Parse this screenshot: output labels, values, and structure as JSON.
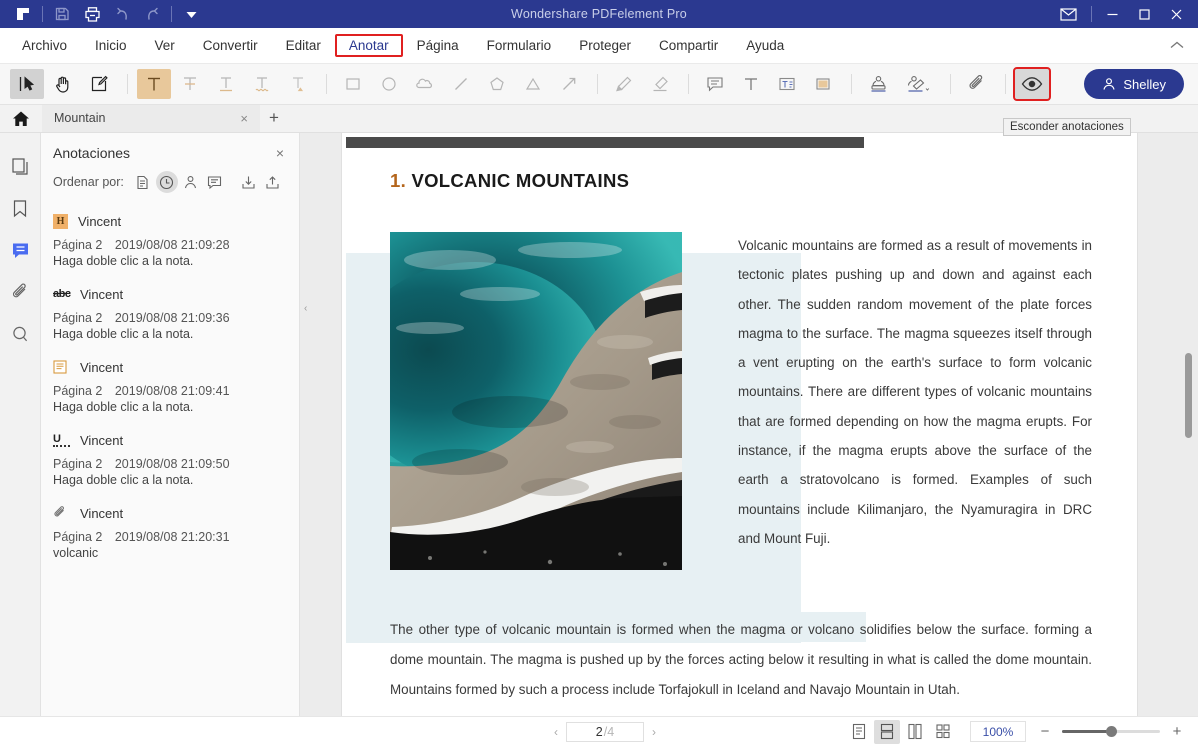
{
  "titlebar": {
    "app_title": "Wondershare PDFelement Pro",
    "background": "#2b3990",
    "left_tools": [
      {
        "name": "logo-icon",
        "label": "PDFelement"
      },
      {
        "name": "save-icon",
        "label": "Guardar"
      },
      {
        "name": "print-icon",
        "label": "Imprimir"
      },
      {
        "name": "undo-icon",
        "label": "Deshacer"
      },
      {
        "name": "redo-icon",
        "label": "Rehacer"
      },
      {
        "name": "customize-dropdown-icon",
        "label": "Personalizar"
      }
    ],
    "right_tools": [
      {
        "name": "mail-icon",
        "label": "Correo"
      },
      {
        "name": "minimize-button",
        "label": "Minimizar"
      },
      {
        "name": "maximize-button",
        "label": "Maximizar"
      },
      {
        "name": "close-button",
        "label": "Cerrar"
      }
    ]
  },
  "menubar": {
    "items": [
      {
        "label": "Archivo",
        "active": false
      },
      {
        "label": "Inicio",
        "active": false
      },
      {
        "label": "Ver",
        "active": false
      },
      {
        "label": "Convertir",
        "active": false
      },
      {
        "label": "Editar",
        "active": false
      },
      {
        "label": "Anotar",
        "active": true
      },
      {
        "label": "Página",
        "active": false
      },
      {
        "label": "Formulario",
        "active": false
      },
      {
        "label": "Proteger",
        "active": false
      },
      {
        "label": "Compartir",
        "active": false
      },
      {
        "label": "Ayuda",
        "active": false
      }
    ],
    "active_tab": "Anotar",
    "active_highlight_color": "#e02020"
  },
  "toolbar": {
    "tools": [
      {
        "name": "select-tool",
        "label": "Seleccionar",
        "selected": true
      },
      {
        "name": "hand-tool",
        "label": "Mano",
        "selected": false
      },
      {
        "name": "edit-note-tool",
        "label": "Editar nota",
        "selected": false
      },
      {
        "name": "highlight-tool",
        "label": "Resaltar",
        "selected": true
      },
      {
        "name": "strikethrough-tool",
        "label": "Tachado",
        "selected": false
      },
      {
        "name": "underline-tool",
        "label": "Subrayar",
        "selected": false
      },
      {
        "name": "squiggly-underline-tool",
        "label": "Subrayado ondulado",
        "selected": false
      },
      {
        "name": "caret-tool",
        "label": "Insertar texto",
        "selected": false
      },
      {
        "name": "rectangle-tool",
        "label": "Rectángulo",
        "selected": false
      },
      {
        "name": "ellipse-tool",
        "label": "Elipse",
        "selected": false
      },
      {
        "name": "cloud-tool",
        "label": "Nube",
        "selected": false
      },
      {
        "name": "line-tool",
        "label": "Línea",
        "selected": false
      },
      {
        "name": "polygon-tool",
        "label": "Polígono",
        "selected": false
      },
      {
        "name": "polyline-tool",
        "label": "Polilínea",
        "selected": false
      },
      {
        "name": "arrow-tool",
        "label": "Flecha",
        "selected": false
      },
      {
        "name": "pencil-tool",
        "label": "Lápiz",
        "selected": false
      },
      {
        "name": "eraser-tool",
        "label": "Borrador",
        "selected": false
      },
      {
        "name": "sticky-note-tool",
        "label": "Nota",
        "selected": false
      },
      {
        "name": "text-box-tool",
        "label": "Cuadro de texto",
        "selected": false
      },
      {
        "name": "typewriter-tool",
        "label": "Máquina de escribir",
        "selected": false
      },
      {
        "name": "text-area-tool",
        "label": "Área de texto",
        "selected": false
      },
      {
        "name": "stamp-tool",
        "label": "Sello",
        "selected": false
      },
      {
        "name": "signature-tool",
        "label": "Firma",
        "selected": false
      },
      {
        "name": "attachment-tool",
        "label": "Adjunto",
        "selected": false
      },
      {
        "name": "hide-annotations-tool",
        "label": "Esconder anotaciones",
        "selected": false,
        "outlined": true
      }
    ],
    "tooltip": "Esconder anotaciones",
    "user_name": "Shelley"
  },
  "tabstrip": {
    "home_label": "Inicio",
    "document_tab": "Mountain",
    "new_tab_label": "+"
  },
  "rail": {
    "items": [
      {
        "name": "sidebar-item-thumbnails",
        "label": "Miniaturas",
        "active": false
      },
      {
        "name": "sidebar-item-bookmarks",
        "label": "Marcadores",
        "active": false
      },
      {
        "name": "sidebar-item-comments",
        "label": "Comentarios",
        "active": true
      },
      {
        "name": "sidebar-item-attachments",
        "label": "Adjuntos",
        "active": false
      },
      {
        "name": "sidebar-item-search",
        "label": "Buscar",
        "active": false
      }
    ],
    "active_color": "#4a6cf0"
  },
  "annotations_panel": {
    "title": "Anotaciones",
    "close_label": "×",
    "sort_label": "Ordenar por:",
    "sort_options": [
      {
        "name": "sort-by-page-icon",
        "label": "Página",
        "active": false
      },
      {
        "name": "sort-by-time-icon",
        "label": "Hora",
        "active": true
      },
      {
        "name": "sort-by-author-icon",
        "label": "Autor",
        "active": false
      },
      {
        "name": "sort-by-type-icon",
        "label": "Tipo",
        "active": false
      }
    ],
    "actions": [
      {
        "name": "import-annotations-icon",
        "label": "Importar"
      },
      {
        "name": "export-annotations-icon",
        "label": "Exportar"
      }
    ],
    "items": [
      {
        "icon": "highlight-badge-icon",
        "icon_kind": "highlight",
        "author": "Vincent",
        "page": "Página 2",
        "timestamp": "2019/08/08 21:09:28",
        "text": "Haga doble clic a la nota."
      },
      {
        "icon": "strikethrough-badge-icon",
        "icon_kind": "strikethrough",
        "author": "Vincent",
        "page": "Página 2",
        "timestamp": "2019/08/08 21:09:36",
        "text": "Haga doble clic a la nota."
      },
      {
        "icon": "note-badge-icon",
        "icon_kind": "note",
        "author": "Vincent",
        "page": "Página 2",
        "timestamp": "2019/08/08 21:09:41",
        "text": "Haga doble clic a la nota."
      },
      {
        "icon": "squiggly-badge-icon",
        "icon_kind": "squiggly",
        "author": "Vincent",
        "page": "Página 2",
        "timestamp": "2019/08/08 21:09:50",
        "text": "Haga doble clic a la nota."
      },
      {
        "icon": "attachment-badge-icon",
        "icon_kind": "attachment",
        "author": "Vincent",
        "page": "Página 2",
        "timestamp": "2019/08/08 21:20:31",
        "text": "volcanic"
      }
    ]
  },
  "document": {
    "heading_number": "1.",
    "heading_text": " VOLCANIC MOUNTAINS",
    "heading_number_color": "#b4651b",
    "image_alt": "Aerial photo of a turquoise hot spring pool with mineral-crusted rim",
    "column_text": "Volcanic mountains are formed as a result of movements in tectonic plates pushing up and down and against each other. The sudden random movement of the plate forces magma to the surface. The magma squeezes itself through a vent erupting on the earth's surface to form volcanic mountains. There are different types of volcanic mountains that are formed depending on how the magma erupts. For instance, if the magma erupts above the surface of the earth a stratovolcano is formed. Examples of such mountains include Kilimanjaro, the Nyamuragira in DRC and Mount Fuji.",
    "paragraph_two": "The other type of volcanic mountain is formed when the magma or volcano solidifies below the surface. forming a dome mountain. The magma is pushed up by the forces acting below it resulting in what is called the dome mountain. Mountains formed by such a process include Torfajokull in Iceland and Navajo Mountain in Utah.",
    "selection_tint_color": "#e7f0f3"
  },
  "statusbar": {
    "prev_label": "‹",
    "next_label": "›",
    "current_page": "2",
    "total_pages": "/4",
    "view_modes": [
      {
        "name": "view-mode-single-page",
        "label": "Una página",
        "active": false
      },
      {
        "name": "view-mode-continuous",
        "label": "Continuo",
        "active": true
      },
      {
        "name": "view-mode-two-page",
        "label": "Dos páginas",
        "active": false
      },
      {
        "name": "view-mode-grid",
        "label": "Cuadrícula",
        "active": false
      }
    ],
    "zoom_value": "100%",
    "zoom_out_label": "−",
    "zoom_in_label": "+"
  }
}
